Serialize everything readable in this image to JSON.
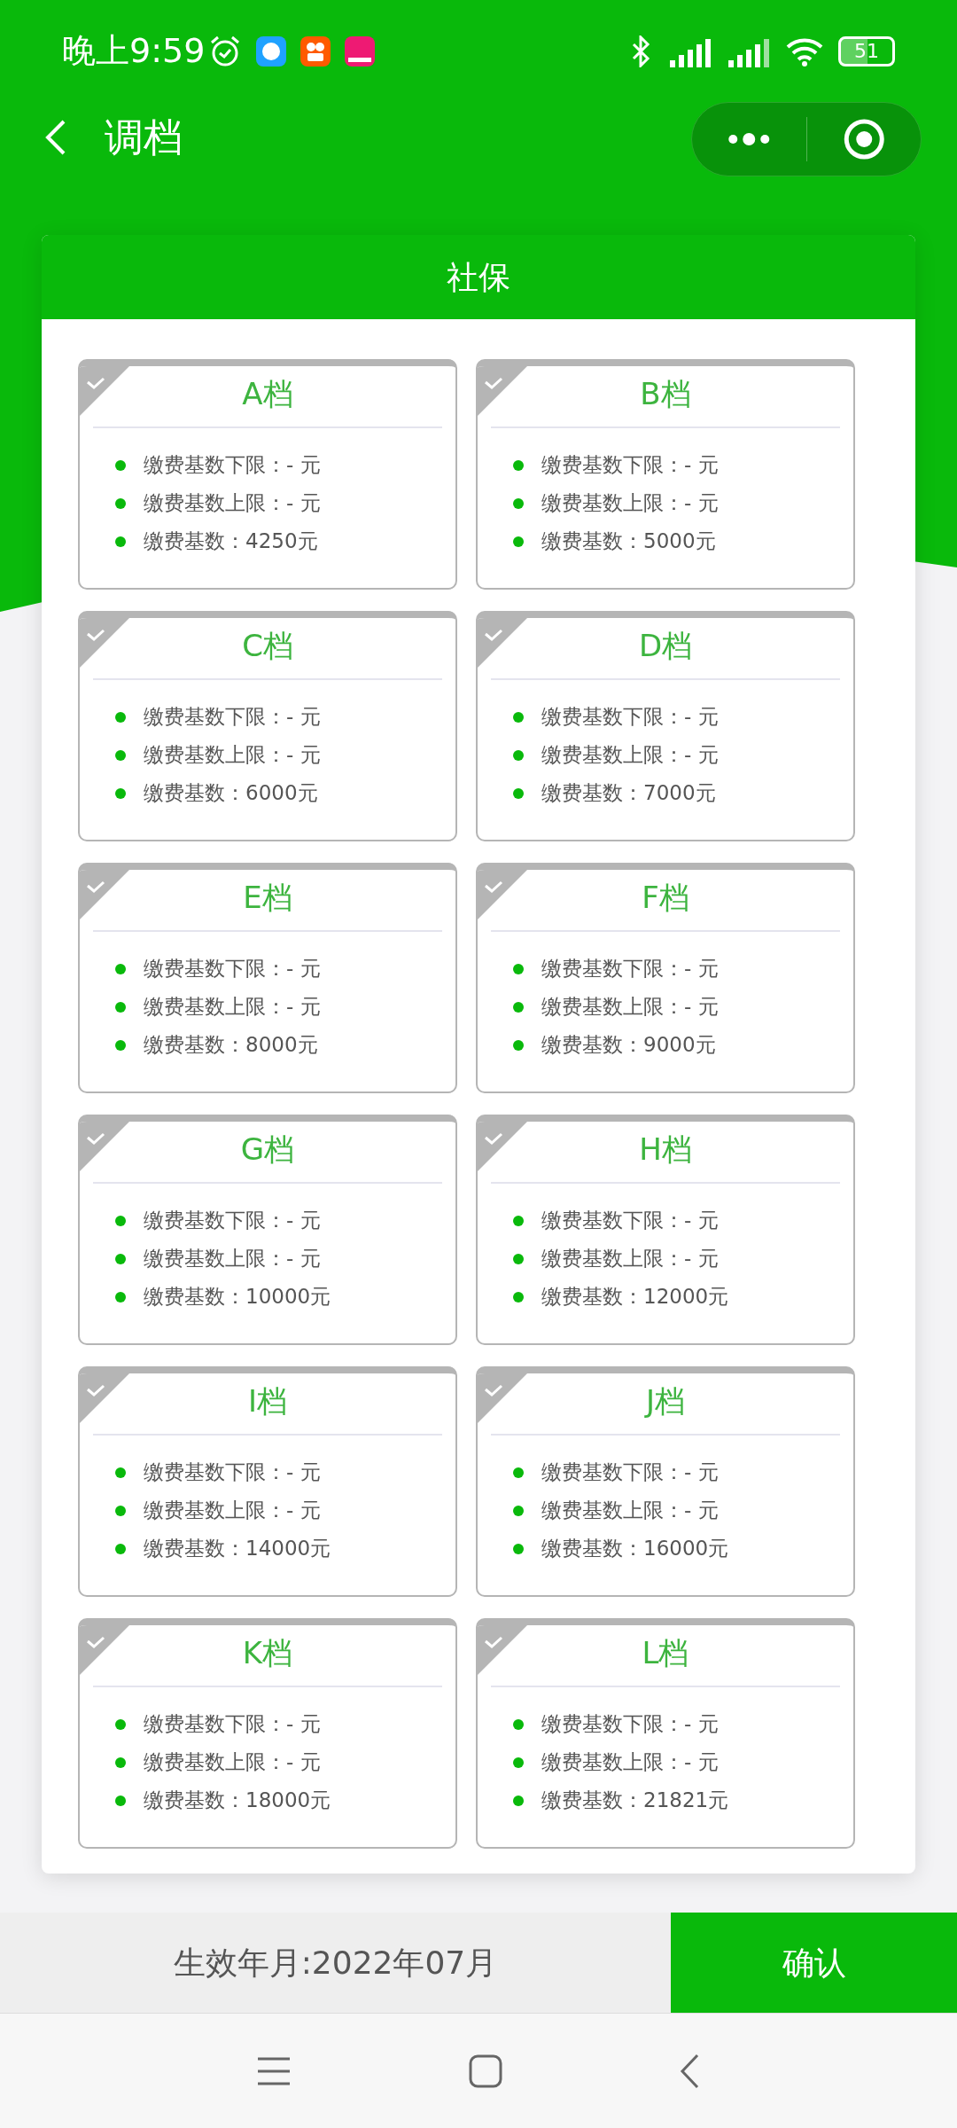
{
  "status_bar": {
    "time": "晚上9:59",
    "battery": "51"
  },
  "title": "调档",
  "section_title": "社保",
  "tiers": [
    {
      "name": "A档",
      "selected": false,
      "lines": [
        "缴费基数下限：- 元",
        "缴费基数上限：- 元",
        "缴费基数：4250元"
      ]
    },
    {
      "name": "B档",
      "selected": false,
      "lines": [
        "缴费基数下限：- 元",
        "缴费基数上限：- 元",
        "缴费基数：5000元"
      ]
    },
    {
      "name": "C档",
      "selected": false,
      "lines": [
        "缴费基数下限：- 元",
        "缴费基数上限：- 元",
        "缴费基数：6000元"
      ]
    },
    {
      "name": "D档",
      "selected": false,
      "lines": [
        "缴费基数下限：- 元",
        "缴费基数上限：- 元",
        "缴费基数：7000元"
      ]
    },
    {
      "name": "E档",
      "selected": false,
      "lines": [
        "缴费基数下限：- 元",
        "缴费基数上限：- 元",
        "缴费基数：8000元"
      ]
    },
    {
      "name": "F档",
      "selected": false,
      "lines": [
        "缴费基数下限：- 元",
        "缴费基数上限：- 元",
        "缴费基数：9000元"
      ]
    },
    {
      "name": "G档",
      "selected": false,
      "lines": [
        "缴费基数下限：- 元",
        "缴费基数上限：- 元",
        "缴费基数：10000元"
      ]
    },
    {
      "name": "H档",
      "selected": false,
      "lines": [
        "缴费基数下限：- 元",
        "缴费基数上限：- 元",
        "缴费基数：12000元"
      ]
    },
    {
      "name": "I档",
      "selected": false,
      "lines": [
        "缴费基数下限：- 元",
        "缴费基数上限：- 元",
        "缴费基数：14000元"
      ]
    },
    {
      "name": "J档",
      "selected": false,
      "lines": [
        "缴费基数下限：- 元",
        "缴费基数上限：- 元",
        "缴费基数：16000元"
      ]
    },
    {
      "name": "K档",
      "selected": false,
      "lines": [
        "缴费基数下限：- 元",
        "缴费基数上限：- 元",
        "缴费基数：18000元"
      ]
    },
    {
      "name": "L档",
      "selected": false,
      "lines": [
        "缴费基数下限：- 元",
        "缴费基数上限：- 元",
        "缴费基数：21821元"
      ]
    }
  ],
  "footer": {
    "effective": "生效年月:2022年07月",
    "confirm": "确认"
  }
}
